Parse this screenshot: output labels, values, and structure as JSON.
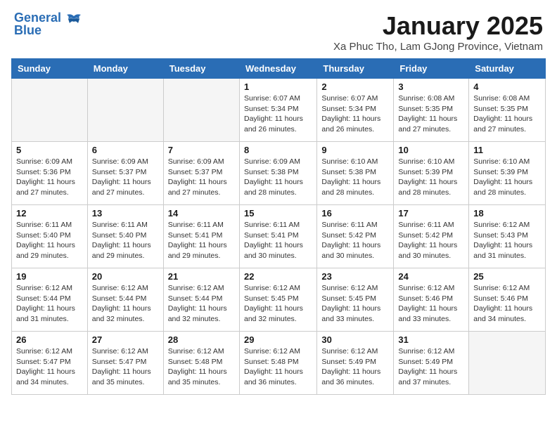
{
  "header": {
    "logo_line1": "General",
    "logo_line2": "Blue",
    "month": "January 2025",
    "location": "Xa Phuc Tho, Lam GJong Province, Vietnam"
  },
  "days_of_week": [
    "Sunday",
    "Monday",
    "Tuesday",
    "Wednesday",
    "Thursday",
    "Friday",
    "Saturday"
  ],
  "weeks": [
    [
      {
        "num": "",
        "info": ""
      },
      {
        "num": "",
        "info": ""
      },
      {
        "num": "",
        "info": ""
      },
      {
        "num": "1",
        "info": "Sunrise: 6:07 AM\nSunset: 5:34 PM\nDaylight: 11 hours and 26 minutes."
      },
      {
        "num": "2",
        "info": "Sunrise: 6:07 AM\nSunset: 5:34 PM\nDaylight: 11 hours and 26 minutes."
      },
      {
        "num": "3",
        "info": "Sunrise: 6:08 AM\nSunset: 5:35 PM\nDaylight: 11 hours and 27 minutes."
      },
      {
        "num": "4",
        "info": "Sunrise: 6:08 AM\nSunset: 5:35 PM\nDaylight: 11 hours and 27 minutes."
      }
    ],
    [
      {
        "num": "5",
        "info": "Sunrise: 6:09 AM\nSunset: 5:36 PM\nDaylight: 11 hours and 27 minutes."
      },
      {
        "num": "6",
        "info": "Sunrise: 6:09 AM\nSunset: 5:37 PM\nDaylight: 11 hours and 27 minutes."
      },
      {
        "num": "7",
        "info": "Sunrise: 6:09 AM\nSunset: 5:37 PM\nDaylight: 11 hours and 27 minutes."
      },
      {
        "num": "8",
        "info": "Sunrise: 6:09 AM\nSunset: 5:38 PM\nDaylight: 11 hours and 28 minutes."
      },
      {
        "num": "9",
        "info": "Sunrise: 6:10 AM\nSunset: 5:38 PM\nDaylight: 11 hours and 28 minutes."
      },
      {
        "num": "10",
        "info": "Sunrise: 6:10 AM\nSunset: 5:39 PM\nDaylight: 11 hours and 28 minutes."
      },
      {
        "num": "11",
        "info": "Sunrise: 6:10 AM\nSunset: 5:39 PM\nDaylight: 11 hours and 28 minutes."
      }
    ],
    [
      {
        "num": "12",
        "info": "Sunrise: 6:11 AM\nSunset: 5:40 PM\nDaylight: 11 hours and 29 minutes."
      },
      {
        "num": "13",
        "info": "Sunrise: 6:11 AM\nSunset: 5:40 PM\nDaylight: 11 hours and 29 minutes."
      },
      {
        "num": "14",
        "info": "Sunrise: 6:11 AM\nSunset: 5:41 PM\nDaylight: 11 hours and 29 minutes."
      },
      {
        "num": "15",
        "info": "Sunrise: 6:11 AM\nSunset: 5:41 PM\nDaylight: 11 hours and 30 minutes."
      },
      {
        "num": "16",
        "info": "Sunrise: 6:11 AM\nSunset: 5:42 PM\nDaylight: 11 hours and 30 minutes."
      },
      {
        "num": "17",
        "info": "Sunrise: 6:11 AM\nSunset: 5:42 PM\nDaylight: 11 hours and 30 minutes."
      },
      {
        "num": "18",
        "info": "Sunrise: 6:12 AM\nSunset: 5:43 PM\nDaylight: 11 hours and 31 minutes."
      }
    ],
    [
      {
        "num": "19",
        "info": "Sunrise: 6:12 AM\nSunset: 5:44 PM\nDaylight: 11 hours and 31 minutes."
      },
      {
        "num": "20",
        "info": "Sunrise: 6:12 AM\nSunset: 5:44 PM\nDaylight: 11 hours and 32 minutes."
      },
      {
        "num": "21",
        "info": "Sunrise: 6:12 AM\nSunset: 5:44 PM\nDaylight: 11 hours and 32 minutes."
      },
      {
        "num": "22",
        "info": "Sunrise: 6:12 AM\nSunset: 5:45 PM\nDaylight: 11 hours and 32 minutes."
      },
      {
        "num": "23",
        "info": "Sunrise: 6:12 AM\nSunset: 5:45 PM\nDaylight: 11 hours and 33 minutes."
      },
      {
        "num": "24",
        "info": "Sunrise: 6:12 AM\nSunset: 5:46 PM\nDaylight: 11 hours and 33 minutes."
      },
      {
        "num": "25",
        "info": "Sunrise: 6:12 AM\nSunset: 5:46 PM\nDaylight: 11 hours and 34 minutes."
      }
    ],
    [
      {
        "num": "26",
        "info": "Sunrise: 6:12 AM\nSunset: 5:47 PM\nDaylight: 11 hours and 34 minutes."
      },
      {
        "num": "27",
        "info": "Sunrise: 6:12 AM\nSunset: 5:47 PM\nDaylight: 11 hours and 35 minutes."
      },
      {
        "num": "28",
        "info": "Sunrise: 6:12 AM\nSunset: 5:48 PM\nDaylight: 11 hours and 35 minutes."
      },
      {
        "num": "29",
        "info": "Sunrise: 6:12 AM\nSunset: 5:48 PM\nDaylight: 11 hours and 36 minutes."
      },
      {
        "num": "30",
        "info": "Sunrise: 6:12 AM\nSunset: 5:49 PM\nDaylight: 11 hours and 36 minutes."
      },
      {
        "num": "31",
        "info": "Sunrise: 6:12 AM\nSunset: 5:49 PM\nDaylight: 11 hours and 37 minutes."
      },
      {
        "num": "",
        "info": ""
      }
    ]
  ]
}
